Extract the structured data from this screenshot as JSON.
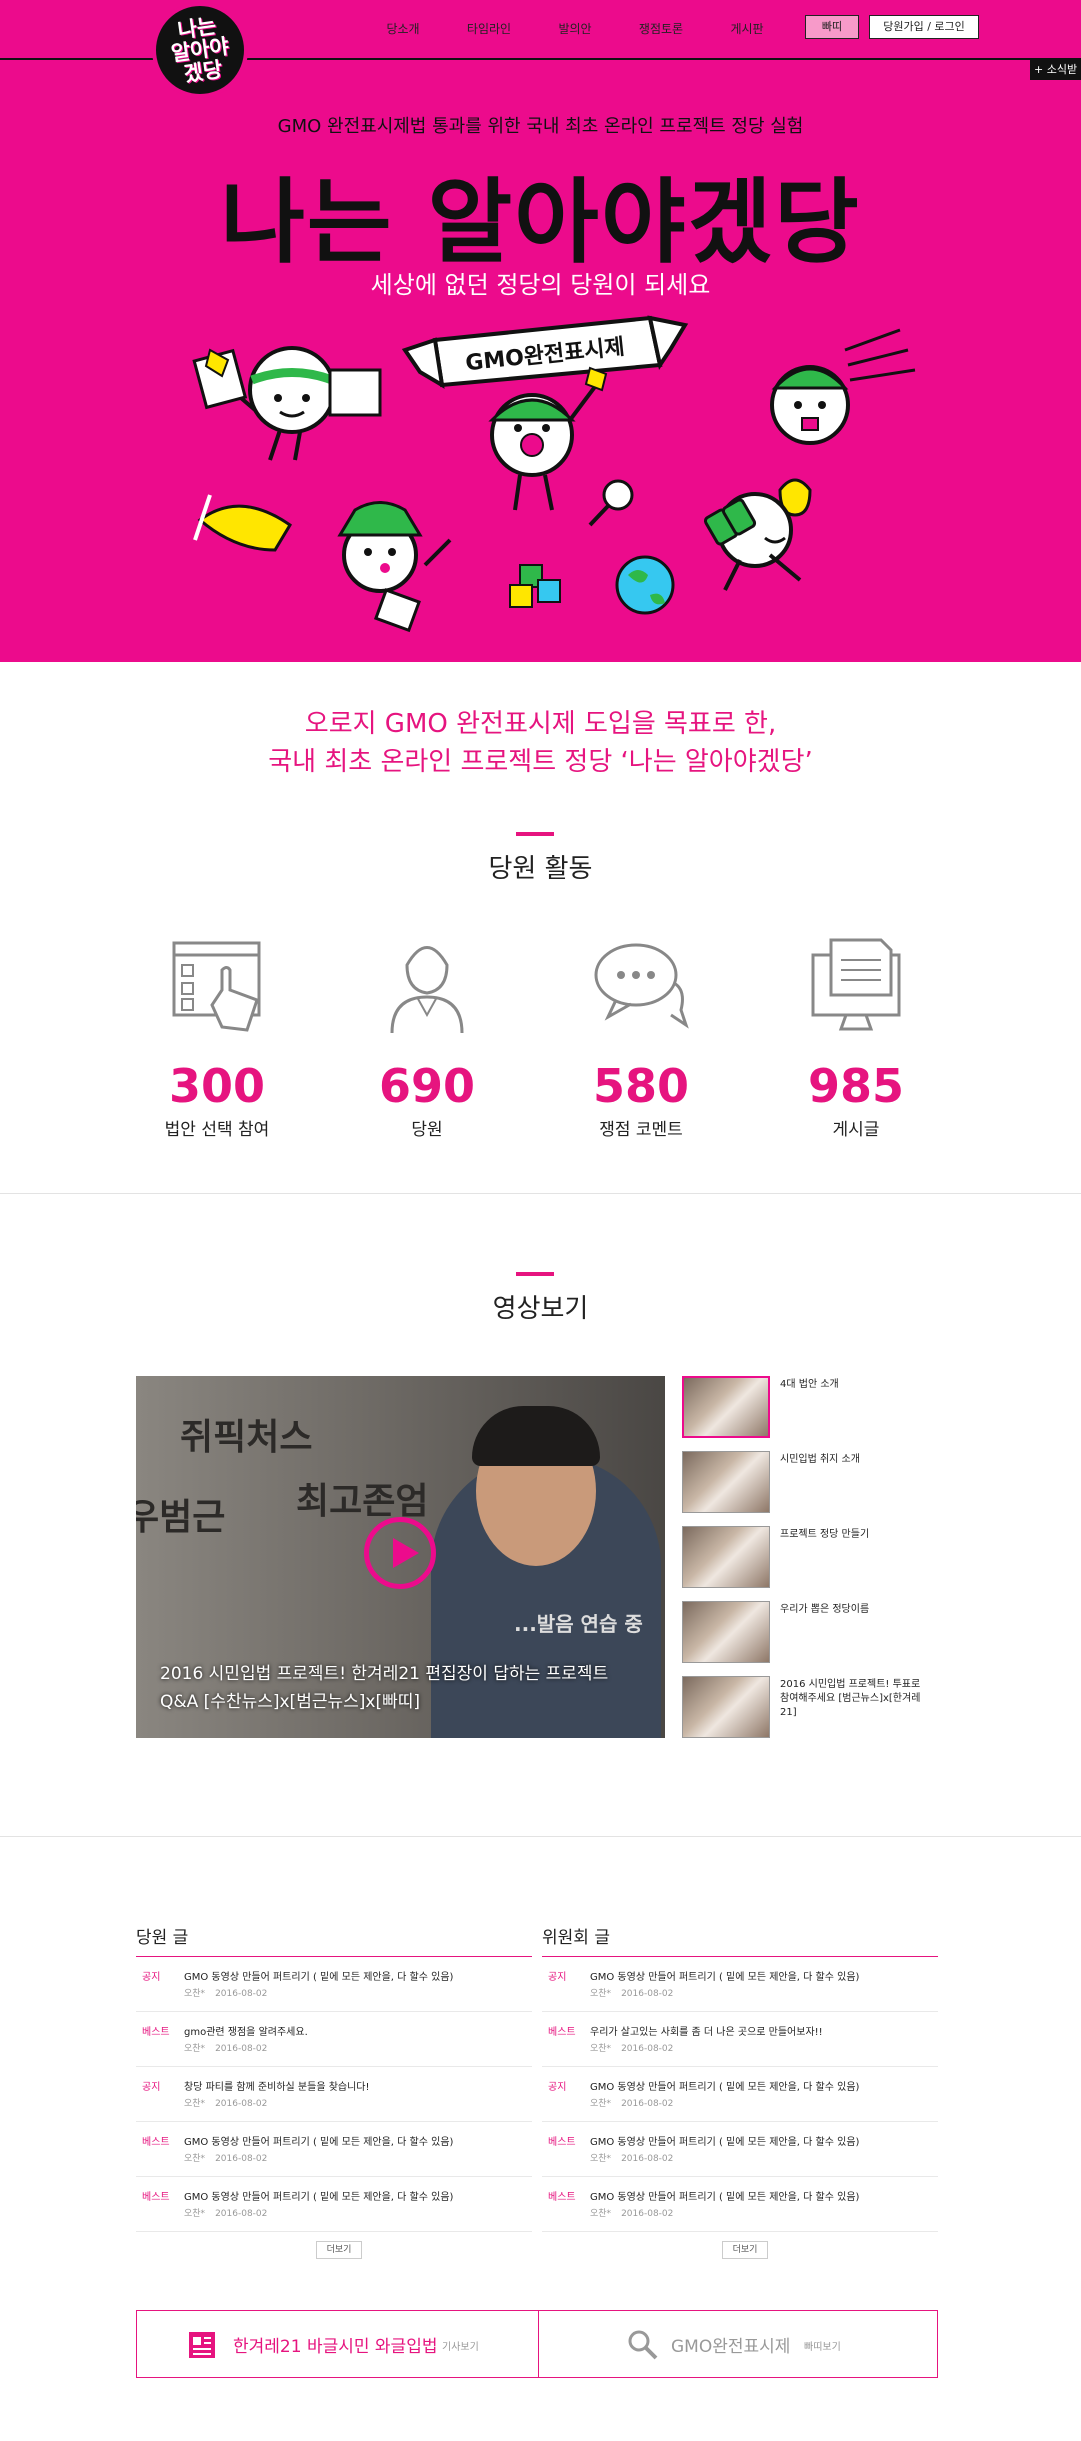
{
  "header": {
    "logo_text": "나는\n알아야\n겠당",
    "nav": [
      "당소개",
      "타임라인",
      "발의안",
      "쟁점토론",
      "게시판"
    ],
    "btn_ppalli": "빠띠",
    "btn_login": "당원가입 / 로그인",
    "news_tab": "+ 소식받"
  },
  "hero": {
    "subtitle": "GMO 완전표시제법 통과를 위한 국내 최초 온라인 프로젝트 정당 실험",
    "title": "나는 알아야겠당",
    "tagline": "세상에 없던 정당의 당원이 되세요",
    "banner_text": "GMO완전표시제"
  },
  "mission": {
    "line1": "오로지 GMO 완전표시제 도입을 목표로 한,",
    "line2": "국내 최초 온라인 프로젝트 정당 ‘나는 알아야겠당’"
  },
  "activity": {
    "title": "당원 활동",
    "stats": [
      {
        "icon": "checklist-icon",
        "value": "300",
        "label": "법안 선택 참여"
      },
      {
        "icon": "person-icon",
        "value": "690",
        "label": "당원"
      },
      {
        "icon": "chat-bubble-icon",
        "value": "580",
        "label": "쟁점 코멘트"
      },
      {
        "icon": "monitor-document-icon",
        "value": "985",
        "label": "게시글"
      }
    ]
  },
  "video": {
    "title": "영상보기",
    "player_writing_1": "쥐픽처스",
    "player_writing_2": "최고존엄",
    "player_writing_3": "우범근",
    "player_writing_4": "...발음 연습 중",
    "main_caption": "2016 시민입법 프로젝트! 한겨레21 편집장이 답하는 프로젝트 Q&A [수찬뉴스]x[범근뉴스]x[빠띠]",
    "list": [
      "4대 법안 소개",
      "시민입법 취지 소개",
      "프로젝트 정당 만들기",
      "우리가 뽑은 정당이름",
      "2016 시민입법 프로젝트! 투표로 참여해주세요 [범근뉴스]x[한겨레21]"
    ]
  },
  "boards": {
    "left": {
      "title": "당원 글",
      "rows": [
        {
          "tag": "공지",
          "text": "GMO 동영상 만들어 퍼트리기 ( 밑에 모든 제안을, 다 할수 있음)",
          "author": "오찬*",
          "date": "2016-08-02"
        },
        {
          "tag": "베스트",
          "text": "gmo관련 쟁점을 알려주세요.",
          "author": "오찬*",
          "date": "2016-08-02"
        },
        {
          "tag": "공지",
          "text": "창당 파티를 함께 준비하실 분들을 찾습니다!",
          "author": "오찬*",
          "date": "2016-08-02"
        },
        {
          "tag": "베스트",
          "text": "GMO 동영상 만들어 퍼트리기 ( 밑에 모든 제안을, 다 할수 있음)",
          "author": "오찬*",
          "date": "2016-08-02"
        },
        {
          "tag": "베스트",
          "text": "GMO 동영상 만들어 퍼트리기 ( 밑에 모든 제안을, 다 할수 있음)",
          "author": "오찬*",
          "date": "2016-08-02"
        }
      ],
      "more": "더보기"
    },
    "right": {
      "title": "위원회 글",
      "rows": [
        {
          "tag": "공지",
          "text": "GMO 동영상 만들어 퍼트리기 ( 밑에 모든 제안을, 다 할수 있음)",
          "author": "오찬*",
          "date": "2016-08-02"
        },
        {
          "tag": "베스트",
          "text": "우리가 살고있는 사회를 좀 더 나은 곳으로 만들어보자!!",
          "author": "오찬*",
          "date": "2016-08-02"
        },
        {
          "tag": "공지",
          "text": "GMO 동영상 만들어 퍼트리기 ( 밑에 모든 제안을, 다 할수 있음)",
          "author": "오찬*",
          "date": "2016-08-02"
        },
        {
          "tag": "베스트",
          "text": "GMO 동영상 만들어 퍼트리기 ( 밑에 모든 제안을, 다 할수 있음)",
          "author": "오찬*",
          "date": "2016-08-02"
        },
        {
          "tag": "베스트",
          "text": "GMO 동영상 만들어 퍼트리기 ( 밑에 모든 제안을, 다 할수 있음)",
          "author": "오찬*",
          "date": "2016-08-02"
        }
      ],
      "more": "더보기"
    }
  },
  "footer_banner": {
    "left_title": "한겨레21 바글시민 와글입법",
    "left_link": "기사보기",
    "left_icon": "newspaper-icon",
    "right_title": "GMO완전표시제",
    "right_link": "빠띠보기",
    "right_icon": "search-icon"
  },
  "colors": {
    "brand_pink": "#ec0b8c",
    "accent_text": "#e6147f",
    "dark": "#111111"
  }
}
